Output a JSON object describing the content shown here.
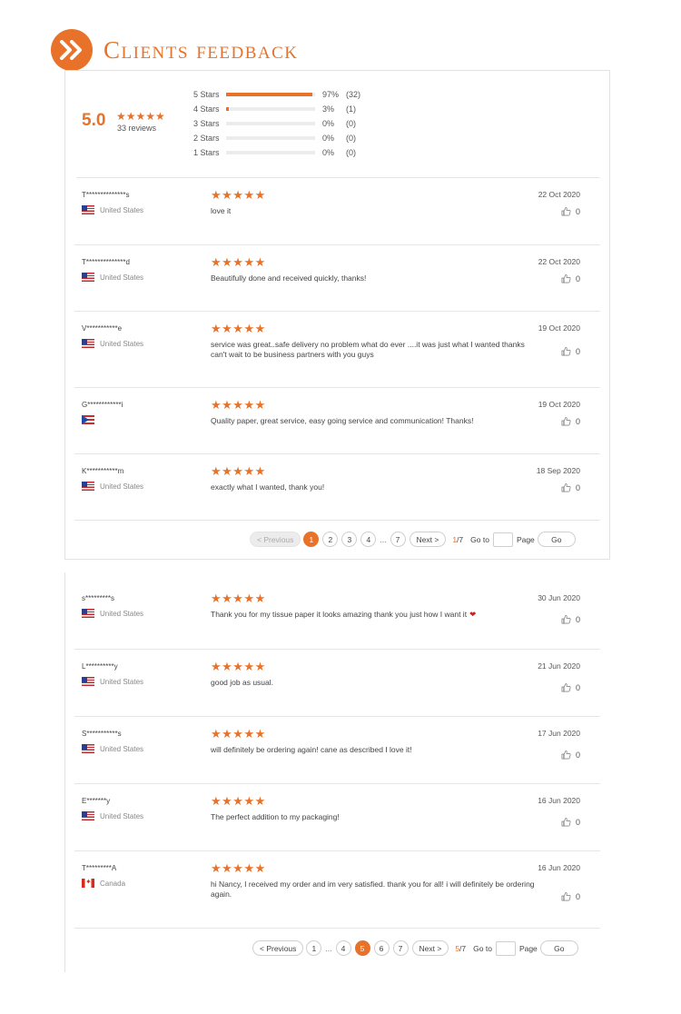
{
  "header": {
    "title": "Clients feedback"
  },
  "summary": {
    "score": "5.0",
    "stars": "★★★★★",
    "count_label": "33 reviews",
    "distribution": [
      {
        "label": "5 Stars",
        "fraction": 0.97,
        "pct": "97%",
        "count": "(32)"
      },
      {
        "label": "4 Stars",
        "fraction": 0.03,
        "pct": "3%",
        "count": "(1)"
      },
      {
        "label": "3 Stars",
        "fraction": 0,
        "pct": "0%",
        "count": "(0)"
      },
      {
        "label": "2 Stars",
        "fraction": 0,
        "pct": "0%",
        "count": "(0)"
      },
      {
        "label": "1 Stars",
        "fraction": 0,
        "pct": "0%",
        "count": "(0)"
      }
    ]
  },
  "colors": {
    "accent": "#e8722a",
    "heart": "#cc1f1f"
  },
  "reviews1": [
    {
      "name": "T**************s",
      "country": "United States",
      "flag": "us",
      "rating": 5,
      "text": "love it",
      "date": "22 Oct 2020",
      "likes": "0"
    },
    {
      "name": "T**************d",
      "country": "United States",
      "flag": "us",
      "rating": 5,
      "text": "Beautifully done and received quickly, thanks!",
      "date": "22 Oct 2020",
      "likes": "0"
    },
    {
      "name": "V***********e",
      "country": "United States",
      "flag": "us",
      "rating": 5,
      "text": "service was great..safe delivery no problem what do ever ....it was just what I wanted thanks can't wait to be business partners with you guys",
      "date": "19 Oct 2020",
      "likes": "0"
    },
    {
      "name": "G************i",
      "country": "",
      "flag": "pr",
      "rating": 5,
      "text": "Quality paper, great service, easy going service and communication! Thanks!",
      "date": "19 Oct 2020",
      "likes": "0"
    },
    {
      "name": "K***********m",
      "country": "United States",
      "flag": "us",
      "rating": 5,
      "text": "exactly what I wanted, thank you!",
      "date": "18 Sep 2020",
      "likes": "0"
    }
  ],
  "pager1": {
    "prev": "< Previous",
    "pages": [
      "1",
      "2",
      "3",
      "4"
    ],
    "dots": "...",
    "last": "7",
    "next": "Next >",
    "current": "1",
    "total": "/7",
    "goto": "Go to",
    "page_label": "Page",
    "go": "Go"
  },
  "reviews2": [
    {
      "name": "s*********s",
      "country": "United States",
      "flag": "us",
      "rating": 5,
      "text": "Thank you for my tissue paper it looks amazing thank you just how I want it",
      "heart": "❤",
      "date": "30 Jun 2020",
      "likes": "0"
    },
    {
      "name": "L**********y",
      "country": "United States",
      "flag": "us",
      "rating": 5,
      "text": "good job as usual.",
      "date": "21 Jun 2020",
      "likes": "0"
    },
    {
      "name": "S***********s",
      "country": "United States",
      "flag": "us",
      "rating": 5,
      "text": "will definitely be ordering again! cane as described I love it!",
      "date": "17 Jun 2020",
      "likes": "0"
    },
    {
      "name": "E*******y",
      "country": "United States",
      "flag": "us",
      "rating": 5,
      "text": "The perfect addition to my packaging!",
      "date": "16 Jun 2020",
      "likes": "0"
    },
    {
      "name": "T*********A",
      "country": "Canada",
      "flag": "ca",
      "rating": 5,
      "text": "hi Nancy, I received my order and im very satisfied. thank you for all! i will definitely be ordering again.",
      "date": "16 Jun 2020",
      "likes": "0"
    }
  ],
  "pager2": {
    "prev": "< Previous",
    "first": "1",
    "dots": "...",
    "pages": [
      "4",
      "5",
      "6",
      "7"
    ],
    "next": "Next >",
    "current": "5",
    "total": "/7",
    "goto": "Go to",
    "page_label": "Page",
    "go": "Go"
  }
}
